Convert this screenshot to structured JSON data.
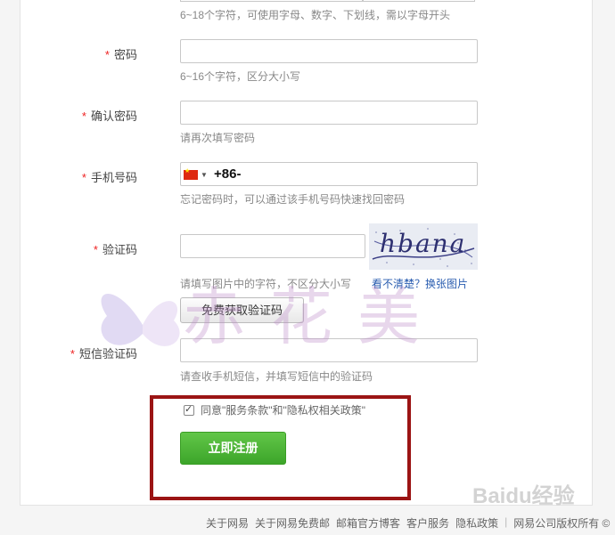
{
  "username": {
    "hint": "6~18个字符，可使用字母、数字、下划线，需以字母开头"
  },
  "password": {
    "star": "*",
    "label": "密码",
    "value": "",
    "hint": "6~16个字符，区分大小写"
  },
  "confirm_password": {
    "star": "*",
    "label": "确认密码",
    "value": "",
    "hint": "请再次填写密码"
  },
  "phone": {
    "star": "*",
    "label": "手机号码",
    "country_code": "+86-",
    "value": "",
    "hint": "忘记密码时，可以通过该手机号码快速找回密码"
  },
  "captcha": {
    "star": "*",
    "label": "验证码",
    "value": "",
    "image_text": "hbana",
    "hint": "请填写图片中的字符，不区分大小写",
    "refresh_link": "看不清楚？换张图片",
    "get_sms_button": "免费获取验证码"
  },
  "sms_code": {
    "star": "*",
    "label": "短信验证码",
    "value": "",
    "hint": "请查收手机短信，并填写短信中的验证码"
  },
  "agreement": {
    "checked": true,
    "text": "同意\"服务条款\"和\"隐私权相关政策\""
  },
  "register_button": "立即注册",
  "footer": {
    "links": [
      "关于网易",
      "关于网易免费邮",
      "邮箱官方博客",
      "客户服务",
      "隐私政策"
    ],
    "separator": "|",
    "copyright": "网易公司版权所有 ©"
  },
  "overlay": {
    "watermark": "赤花美",
    "baidu": "Baidu经验"
  },
  "colors": {
    "required_star": "#ee2222",
    "register_button": "#4cb535",
    "highlight_box": "#9b1414",
    "link": "#2a5db0"
  }
}
